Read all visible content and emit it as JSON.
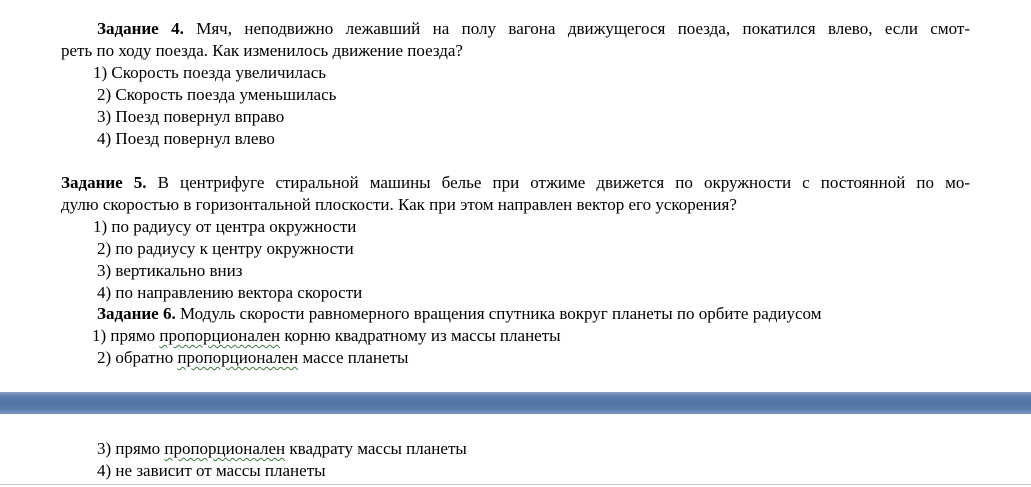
{
  "task4": {
    "label": "Задание 4.",
    "line1": "Мяч, неподвижно лежавший на полу вагона движущегося поезда, покатился влево, если смот-",
    "line2": "реть по ходу поезда. Как изменилось движение поезда?",
    "options": [
      "1) Скорость поезда увеличилась",
      "2) Скорость поезда уменьшилась",
      "3) Поезд повернул вправо",
      "4) Поезд повернул влево"
    ]
  },
  "task5": {
    "label": "Задание 5.",
    "line1": "В центрифуге стиральной машины белье при отжиме движется по окружности с постоянной по мо-",
    "line2": "дулю скоростью в горизонтальной плоскости. Как при этом направлен вектор его ускорения?",
    "options": [
      "1) по радиусу от центра окружности",
      "2) по радиусу к центру окружности",
      "3) вертикально вниз",
      "4) по направлению вектора скорости"
    ]
  },
  "task6": {
    "label": "Задание 6.",
    "text": "Модуль скорости равномерного вращения спутника вокруг планеты по орбите радиусом",
    "options": [
      {
        "num": "1) прямо",
        "word": "пропорционален",
        "rest": "корню квадратному из массы планеты"
      },
      {
        "num": "2) обратно",
        "word": "пропорционален",
        "rest": "массе планеты"
      },
      {
        "num": "3) прямо",
        "word": "пропорционален",
        "rest": "квадрату массы планеты"
      },
      {
        "num": "4)",
        "word": "",
        "rest": "не зависит от массы планеты"
      }
    ]
  }
}
